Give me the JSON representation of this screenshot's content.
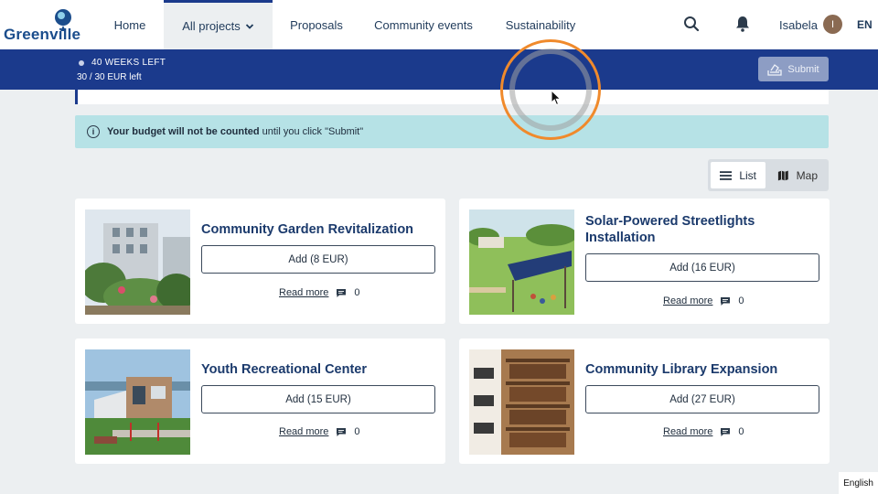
{
  "nav": {
    "logo_text": "Greenville",
    "items": [
      {
        "label": "Home"
      },
      {
        "label": "All projects"
      },
      {
        "label": "Proposals"
      },
      {
        "label": "Community events"
      },
      {
        "label": "Sustainability"
      }
    ],
    "user_name": "Isabela",
    "avatar_initial": "I",
    "language": "EN"
  },
  "budget": {
    "weeks_left": "40 WEEKS LEFT",
    "eur_left": "30 / 30 EUR left",
    "submit_label": "Submit"
  },
  "notice": {
    "bold": "Your budget will not be counted",
    "rest": "until you click \"Submit\""
  },
  "view_toggle": {
    "list_label": "List",
    "map_label": "Map"
  },
  "projects": [
    {
      "title": "Community Garden Revitalization",
      "add_label": "Add (8 EUR)",
      "read_more": "Read more",
      "comments": "0"
    },
    {
      "title": "Solar-Powered Streetlights Installation",
      "add_label": "Add (16 EUR)",
      "read_more": "Read more",
      "comments": "0"
    },
    {
      "title": "Youth Recreational Center",
      "add_label": "Add (15 EUR)",
      "read_more": "Read more",
      "comments": "0"
    },
    {
      "title": "Community Library Expansion",
      "add_label": "Add (27 EUR)",
      "read_more": "Read more",
      "comments": "0"
    }
  ],
  "footer_language": "English",
  "colors": {
    "primary": "#1b3a8c",
    "notice_bg": "#b6e2e6",
    "cursor_ring": "#f08a2c"
  }
}
